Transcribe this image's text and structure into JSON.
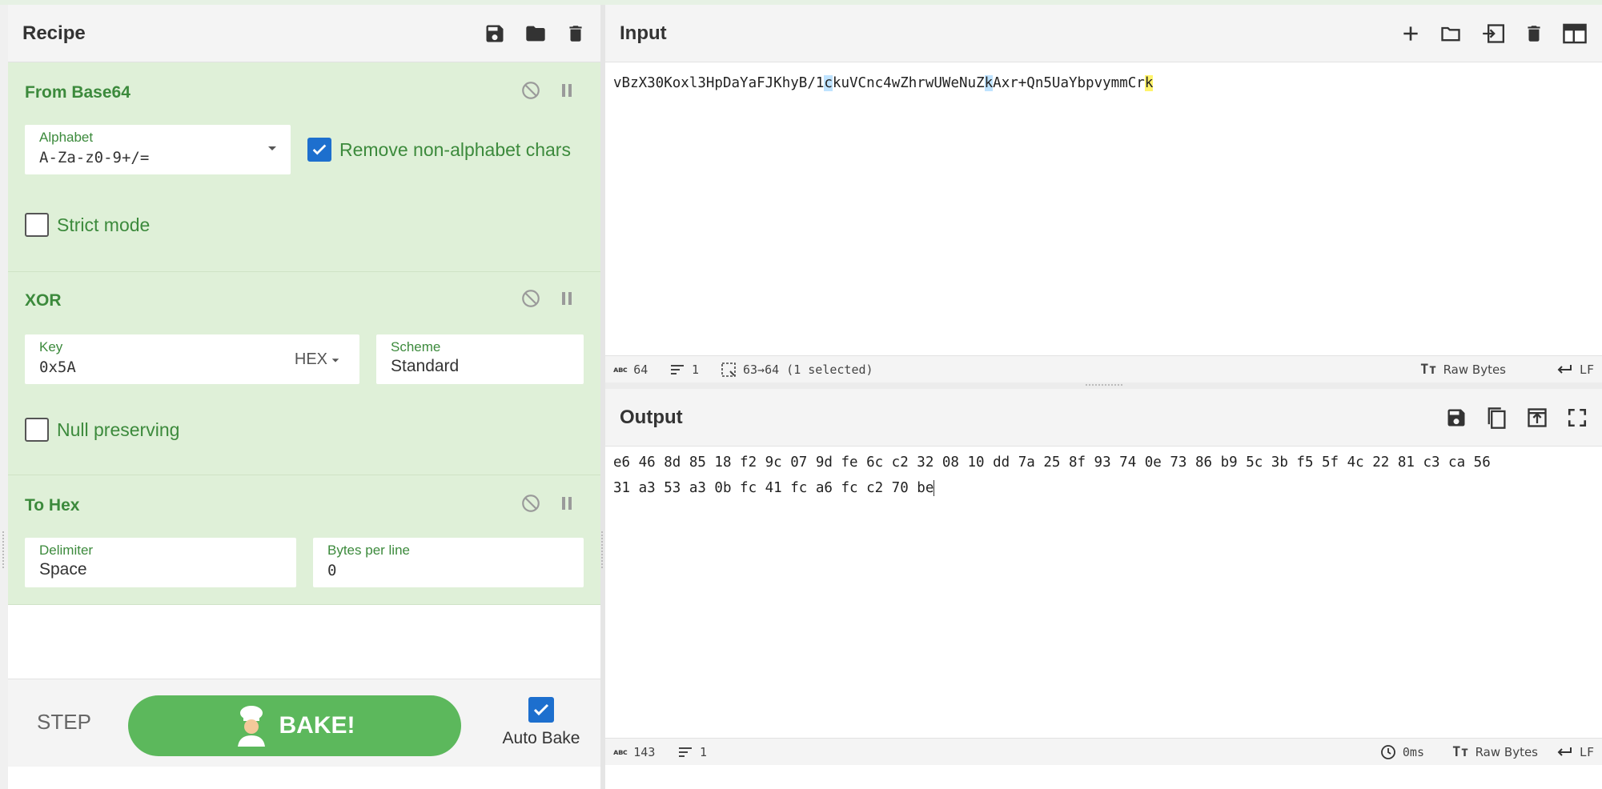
{
  "recipe": {
    "title": "Recipe",
    "header_icons": [
      "save-icon",
      "folder-icon",
      "trash-icon"
    ],
    "operations": [
      {
        "name": "From Base64",
        "alphabet_label": "Alphabet",
        "alphabet_value": "A-Za-z0-9+/=",
        "remove_label": "Remove non-alphabet chars",
        "remove_checked": true,
        "strict_label": "Strict mode",
        "strict_checked": false
      },
      {
        "name": "XOR",
        "key_label": "Key",
        "key_value": "0x5A",
        "key_format": "HEX",
        "scheme_label": "Scheme",
        "scheme_value": "Standard",
        "null_label": "Null preserving",
        "null_checked": false
      },
      {
        "name": "To Hex",
        "delimiter_label": "Delimiter",
        "delimiter_value": "Space",
        "bytes_label": "Bytes per line",
        "bytes_value": "0"
      }
    ],
    "step_label": "STEP",
    "bake_label": "BAKE!",
    "auto_bake_label": "Auto Bake",
    "auto_bake_checked": true
  },
  "input": {
    "title": "Input",
    "text_a": "vBzX30Koxl3HpDaYaFJKhyB/1",
    "text_sel1": "c",
    "text_b": "kuVCnc4wZhrwUWeNuZ",
    "text_sel2": "k",
    "text_c": "Axr+Qn5UaYbpvymmCr",
    "text_sel3": "k",
    "status": {
      "length": "64",
      "lines": "1",
      "selection": "63→64 (1 selected)",
      "encoding": "Raw Bytes",
      "eol": "LF"
    }
  },
  "output": {
    "title": "Output",
    "line1": "e6 46 8d 85 18 f2 9c 07 9d fe 6c c2 32 08 10 dd 7a 25 8f 93 74 0e 73 86 b9 5c 3b f5 5f 4c 22 81 c3 ca 56",
    "line2": "31 a3 53 a3 0b fc 41 fc a6 fc c2 70 be",
    "status": {
      "length": "143",
      "lines": "1",
      "time": "0ms",
      "encoding": "Raw Bytes",
      "eol": "LF"
    }
  },
  "colors": {
    "op_bg": "#dff0d8",
    "op_text": "#3c8a3c",
    "bake": "#5cb85c",
    "checkbox": "#1d6fce"
  }
}
